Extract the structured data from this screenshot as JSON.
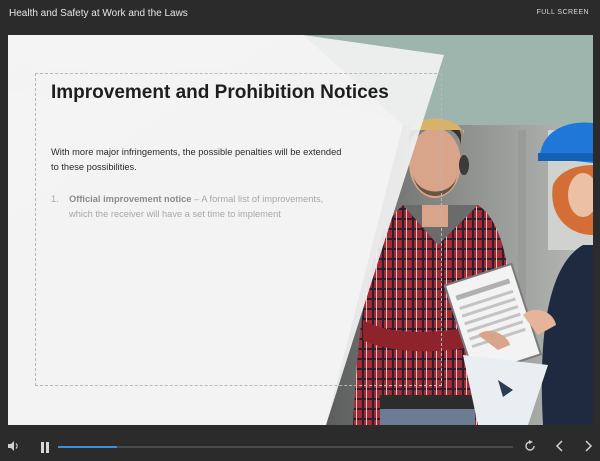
{
  "header": {
    "course_title": "Health and Safety at Work and the Laws",
    "fullscreen_label": "FULL SCREEN"
  },
  "slide": {
    "title": "Improvement and Prohibition Notices",
    "body": "With more major infringements, the possible penalties will be extended to these possibilities.",
    "list": [
      {
        "number": "1.",
        "term": "Official improvement notice",
        "separator": " – ",
        "description": "A formal list of improvements, which the receiver will have a set time to implement"
      }
    ],
    "image": "construction-workers-reviewing-clipboard"
  },
  "player": {
    "progress": 0.13,
    "progress_color": "#3d8fd6",
    "accent_color": "#9db5ac",
    "controls": [
      "volume-icon",
      "pause-icon",
      "replay-icon",
      "previous-icon",
      "next-icon"
    ]
  }
}
